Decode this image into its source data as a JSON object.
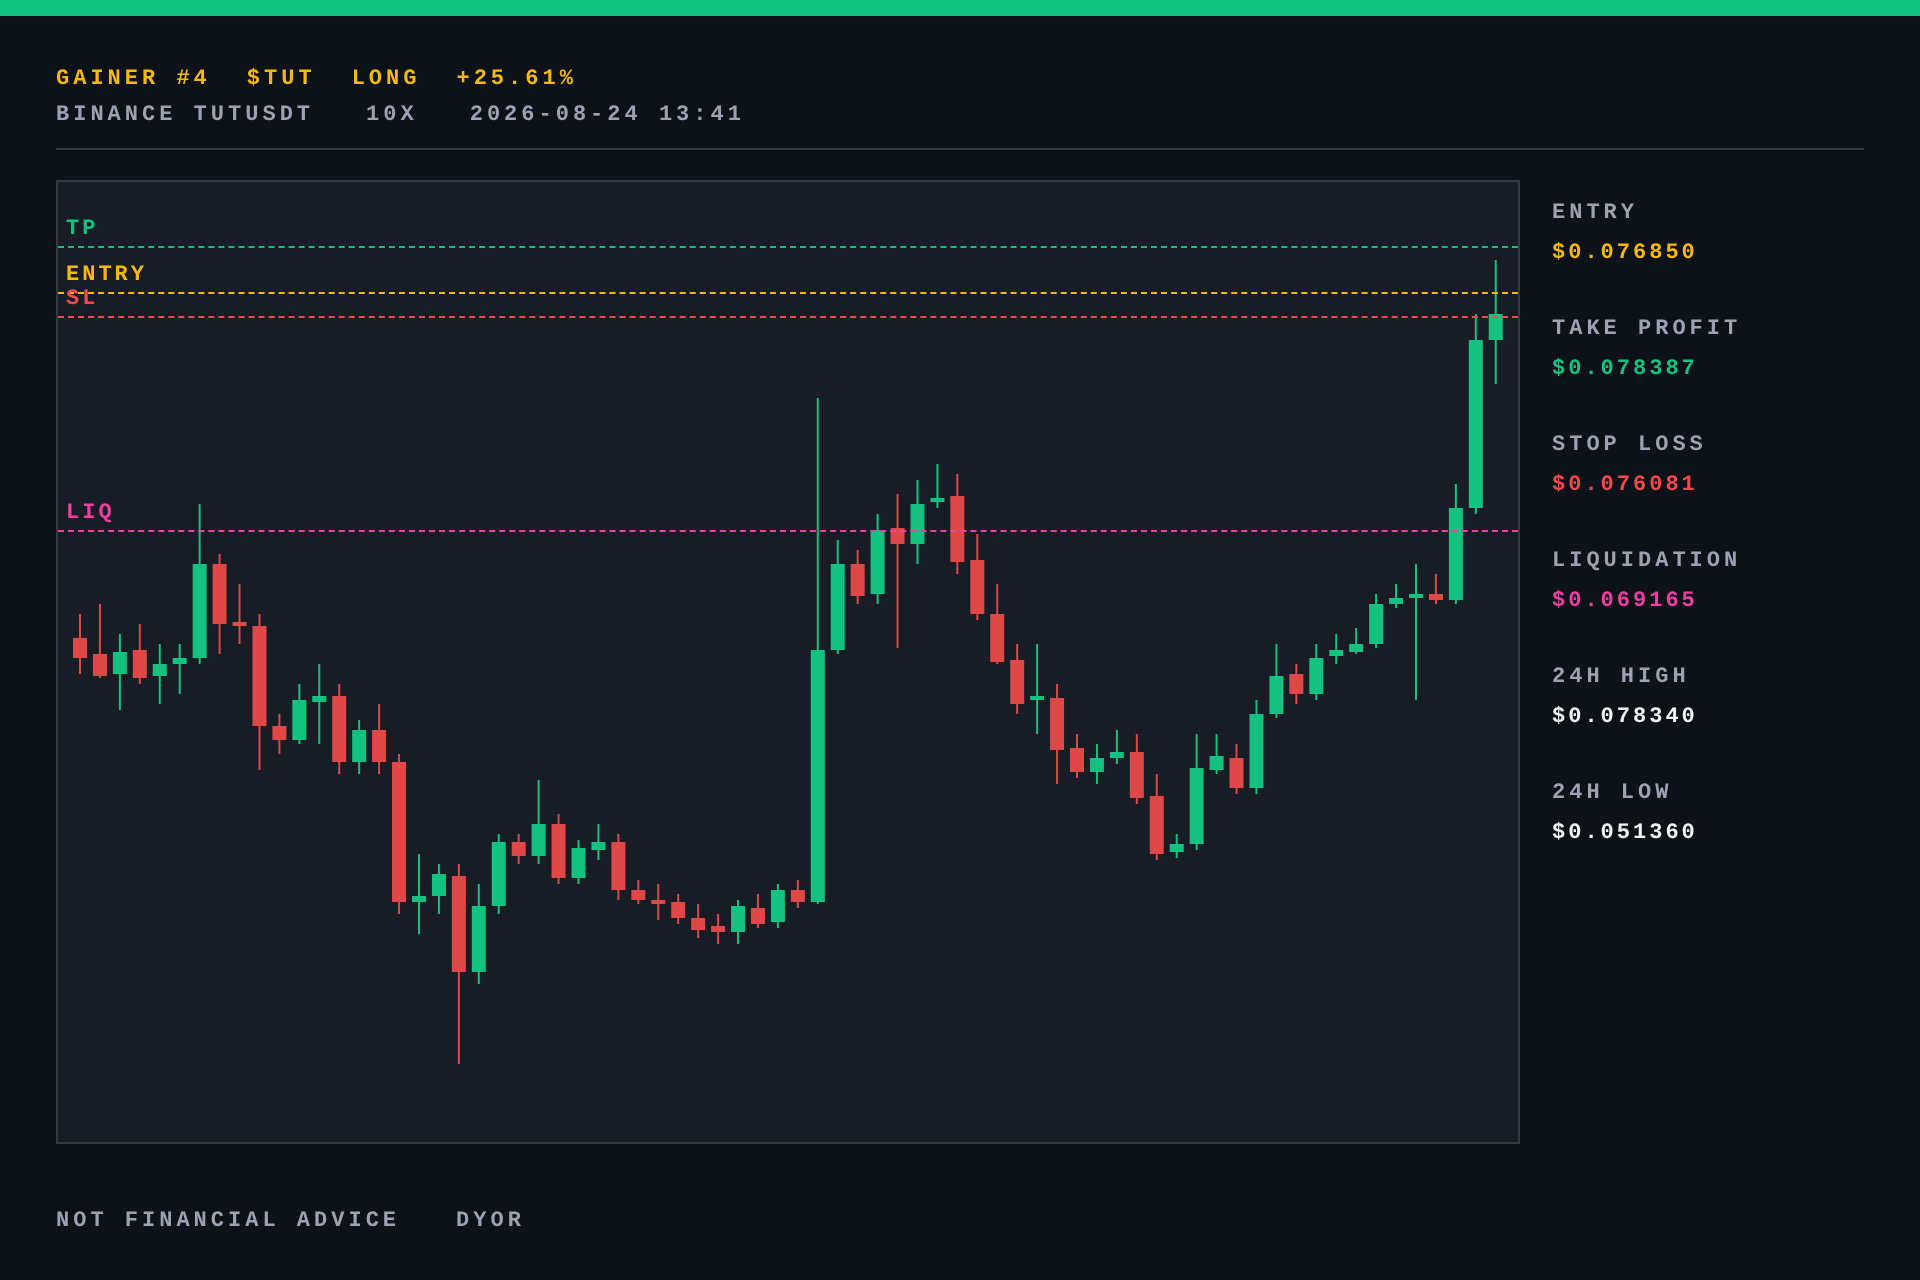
{
  "header": {
    "title_items": [
      "GAINER #4",
      "$TUT",
      "LONG",
      "+25.61%"
    ],
    "subtitle_items": [
      "BINANCE TUTUSDT",
      "10X",
      "2026-08-24 13:41"
    ]
  },
  "chart": {
    "levels": [
      {
        "label": "TP",
        "color": "#12c27e"
      },
      {
        "label": "ENTRY",
        "color": "#f5b90c"
      },
      {
        "label": "SL",
        "color": "#f04a4a"
      },
      {
        "label": "LIQ",
        "color": "#ef3ea4"
      }
    ]
  },
  "stats": [
    {
      "label": "ENTRY",
      "value": "$0.076850",
      "color": "#f5b90c"
    },
    {
      "label": "TAKE PROFIT",
      "value": "$0.078387",
      "color": "#12c27e"
    },
    {
      "label": "STOP LOSS",
      "value": "$0.076081",
      "color": "#f04a4a"
    },
    {
      "label": "LIQUIDATION",
      "value": "$0.069165",
      "color": "#ef3ea4"
    },
    {
      "label": "24H HIGH",
      "value": "$0.078340",
      "color": "#f2f2f2"
    },
    {
      "label": "24H LOW",
      "value": "$0.051360",
      "color": "#f2f2f2"
    }
  ],
  "footer": [
    "NOT FINANCIAL ADVICE",
    "DYOR"
  ]
}
